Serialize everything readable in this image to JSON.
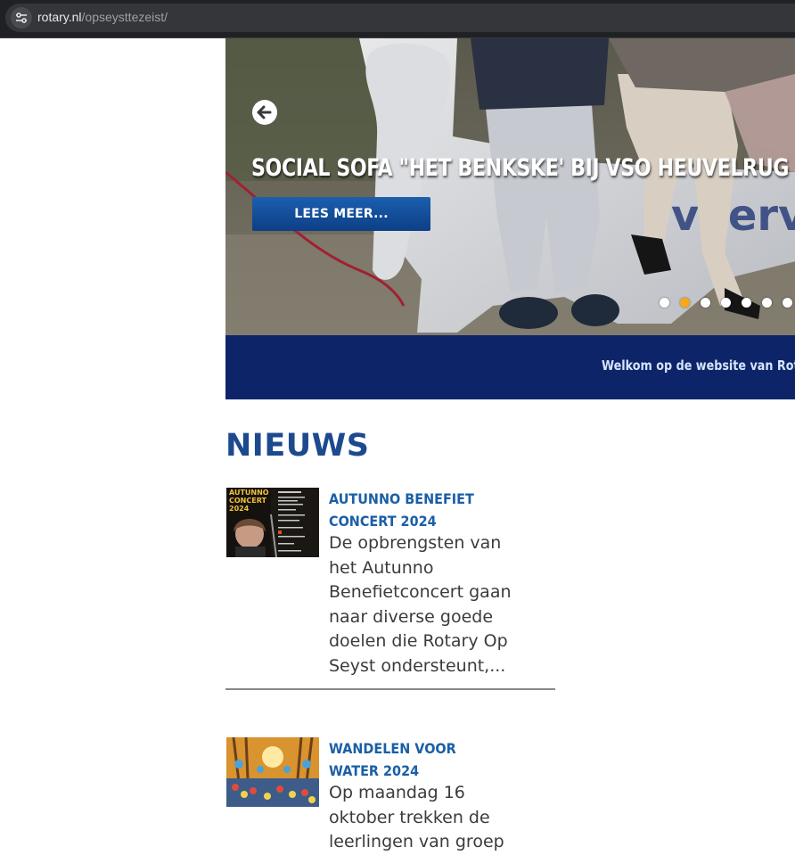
{
  "browser": {
    "url_domain": "rotary.nl",
    "url_path": "/opseysttezeist/",
    "site_info_icon": "tune-icon"
  },
  "hero": {
    "slide_title": "SOCIAL SOFA \"HET BENKSKE' BIJ VSO HEUVELRUG",
    "button_label": "LEES MEER...",
    "prev_icon": "arrow-left-icon",
    "dots_total": 7,
    "active_dot_index": 1,
    "active_dot_color": "#f7a81b"
  },
  "banner": {
    "text": "Welkom op de website van Rota"
  },
  "news": {
    "heading": "NIEUWS",
    "items": [
      {
        "title": "AUTUNNO BENEFIET CONCERT 2024",
        "excerpt": "De opbrengsten van het Autunno Benefietconcert gaan naar diverse goede doelen die Rotary Op Seyst ondersteunt,...",
        "thumb_caption": "AUTUNNO CONCERT 2024"
      },
      {
        "title": "WANDELEN VOOR WATER 2024",
        "excerpt": "Op maandag 16 oktober trekken de leerlingen van groep"
      }
    ]
  },
  "colors": {
    "brand_blue": "#1d4a8e",
    "banner_navy": "#0d2568",
    "link_blue": "#1a5fa6",
    "rotary_gold": "#f7a81b"
  }
}
